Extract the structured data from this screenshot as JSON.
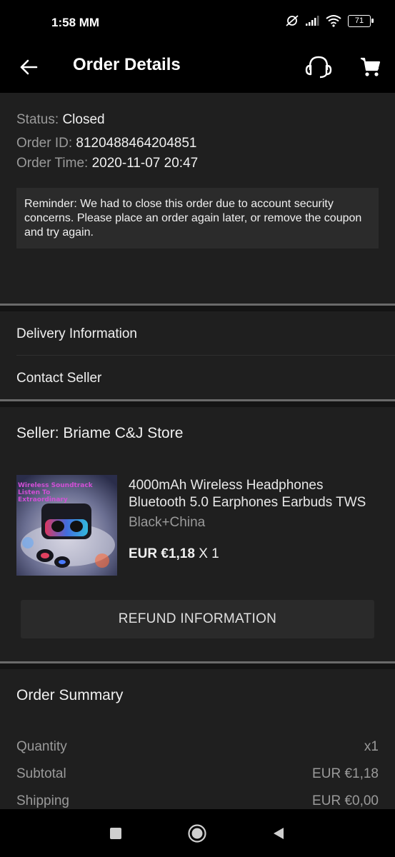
{
  "status_bar": {
    "time": "1:58 MM",
    "battery": "71"
  },
  "header": {
    "title": "Order Details"
  },
  "order": {
    "status_label": "Status:",
    "status_value": "Closed",
    "id_label": "Order ID:",
    "id_value": "8120488464204851",
    "time_label": "Order Time:",
    "time_value": "2020-11-07 20:47",
    "reminder": "Reminder: We had to close this order due to account security concerns. Please place an order again later, or remove the coupon and try again."
  },
  "links": {
    "delivery": "Delivery Information",
    "contact": "Contact Seller"
  },
  "seller": {
    "label": "Seller: Briame C&J Store"
  },
  "product": {
    "title_line1": "4000mAh Wireless Headphones",
    "title_line2": "Bluetooth 5.0 Earphones Earbuds TWS",
    "variant": "Black+China",
    "price": "EUR €1,18",
    "quantity": "X 1",
    "image_text_1": "Wireless Soundtrack",
    "image_text_2": "Listen To",
    "image_text_3": "Extraordinary"
  },
  "refund_button": "REFUND INFORMATION",
  "summary": {
    "title": "Order Summary",
    "rows": [
      {
        "label": "Quantity",
        "value": "x1"
      },
      {
        "label": "Subtotal",
        "value": "EUR €1,18"
      },
      {
        "label": "Shipping",
        "value": "EUR €0,00"
      }
    ]
  },
  "colors": {
    "background": "#000000",
    "surface": "#1f1f1f",
    "reminder_bg": "#2b2b2b",
    "divider": "#6a6a6a",
    "text_primary": "#f0f0f0",
    "text_secondary": "#9a9a9a"
  },
  "icons": {
    "back": "arrow-left-icon",
    "support": "headset-icon",
    "cart": "shopping-cart-icon",
    "nav_recents": "square-icon",
    "nav_home": "circle-icon",
    "nav_back": "triangle-back-icon"
  }
}
